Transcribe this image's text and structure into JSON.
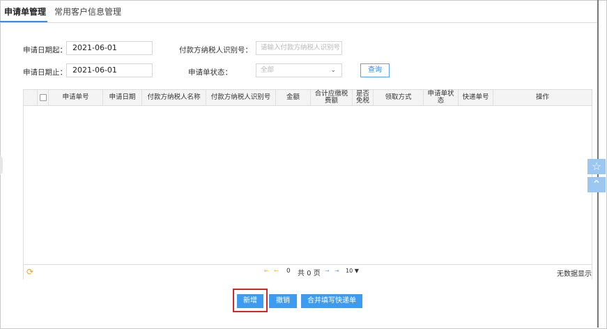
{
  "tabs": [
    {
      "label": "申请单管理",
      "active": true
    },
    {
      "label": "常用客户信息管理",
      "active": false
    }
  ],
  "form": {
    "start_date_label": "申请日期起：",
    "start_date_value": "2021-06-01",
    "end_date_label": "申请日期止：",
    "end_date_value": "2021-06-01",
    "taxpayer_id_label": "付款方纳税人识别号：",
    "taxpayer_id_placeholder": "请输入付款方纳税人识别号",
    "status_label": "申请单状态：",
    "status_value": "全部",
    "query_button": "查询"
  },
  "grid": {
    "columns": [
      "申请单号",
      "申请日期",
      "付款方纳税人名称",
      "付款方纳税人识别号",
      "金额",
      "合计应缴税\n费额",
      "是否\n免税",
      "领取方式",
      "申请单状\n态",
      "快递单号",
      "操作"
    ],
    "rows": [],
    "pager": {
      "current_page": "0",
      "total_pages_text": "共 0 页",
      "page_size": "10 ▼"
    },
    "no_data_text": "无数据显示"
  },
  "actions": {
    "add": "新增",
    "revoke": "撤销",
    "merge_express": "合并填写快递单"
  },
  "side": {
    "favorite_icon": "star-icon",
    "top_icon": "chevron-up-icon"
  },
  "colors": {
    "accent": "#3d9cf0",
    "highlight": "#d9242a"
  }
}
